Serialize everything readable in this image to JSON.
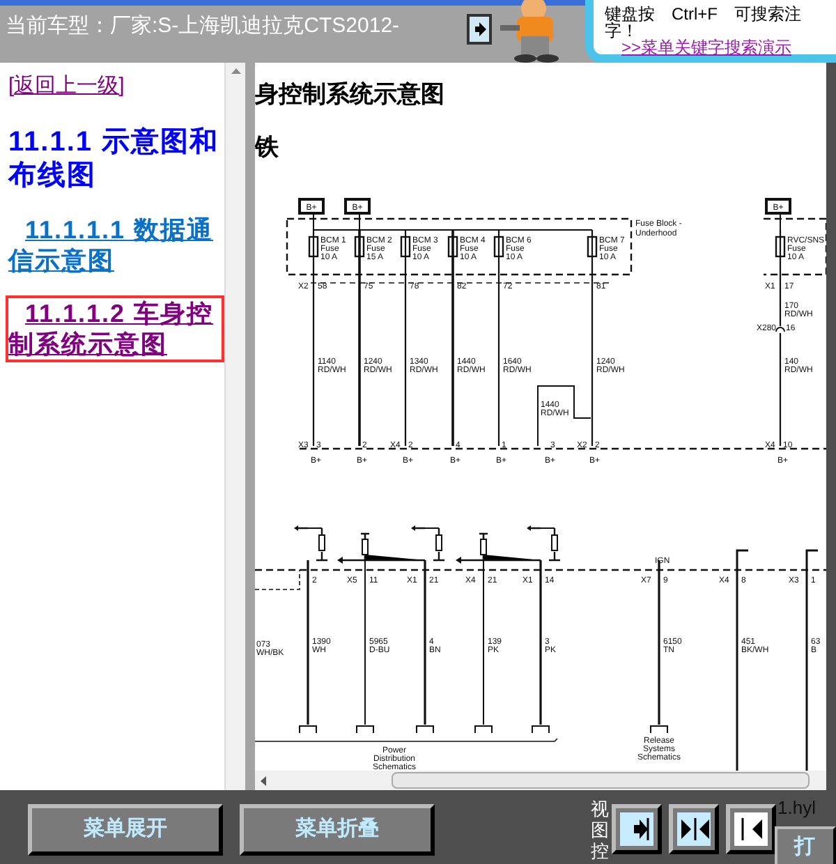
{
  "header": {
    "vehicle": "当前车型：厂家:S-上海凯迪拉克CTS2012-",
    "tip_lines": [
      "键盘按　Ctrl+F　可搜索注",
      "字！"
    ],
    "tip_link": ">>菜单关键字搜索演示"
  },
  "nav": [
    {
      "kind": "back",
      "text": "[返回上一级]",
      "selected": false
    },
    {
      "kind": "heading",
      "text": "11.1.1 示意图和布线图",
      "selected": false
    },
    {
      "kind": "link",
      "text": "11.1.1.1 数据通信示意图",
      "selected": false
    },
    {
      "kind": "link",
      "text": "11.1.1.2 车身控制系统示意图",
      "selected": true
    }
  ],
  "diagram": {
    "heading": "身控制系统示意图",
    "subheading": "铁",
    "fuse_block": [
      "Fuse Block -",
      "Underhood"
    ],
    "circuits": [
      {
        "kind": "fused",
        "supply": "B+",
        "fuse": "BCM 1",
        "fuse_word": "Fuse",
        "rating": "10 A",
        "top_connector": "X2",
        "top_pin": "58",
        "wire": "1140",
        "wire_color": "RD/WH",
        "connector": "X3",
        "pin": "3",
        "terminal": "B+"
      },
      {
        "kind": "fused",
        "supply": "B+",
        "fuse": "BCM 2",
        "fuse_word": "Fuse",
        "rating": "15 A",
        "top_pin": "75",
        "wire": "1240",
        "wire_color": "RD/WH",
        "pin": "2",
        "terminal": "B+"
      },
      {
        "kind": "fused",
        "fuse": "BCM 3",
        "fuse_word": "Fuse",
        "rating": "10 A",
        "top_pin": "78",
        "wire": "1340",
        "wire_color": "RD/WH",
        "connector": "X4",
        "pin": "2",
        "terminal": "B+"
      },
      {
        "kind": "fused",
        "fuse": "BCM 4",
        "fuse_word": "Fuse",
        "rating": "10 A",
        "top_pin": "82",
        "wire": "1440",
        "wire_color": "RD/WH",
        "pin": "4",
        "terminal": "B+"
      },
      {
        "kind": "fused",
        "fuse": "BCM 6",
        "fuse_word": "Fuse",
        "rating": "10 A",
        "top_pin": "72",
        "wire": "1640",
        "wire_color": "RD/WH",
        "pin": "1",
        "terminal": "B+"
      },
      {
        "kind": "jumper",
        "wire": "1440",
        "wire_color": "RD/WH",
        "pin": "3",
        "terminal": "B+"
      },
      {
        "kind": "fused",
        "fuse": "BCM 7",
        "fuse_word": "Fuse",
        "rating": "10 A",
        "top_pin": "81",
        "wire": "1240",
        "wire_color": "RD/WH",
        "connector": "X2",
        "pin": "2",
        "terminal": "B+"
      },
      {
        "kind": "inline",
        "supply": "B+",
        "fuse": "RVC/SNS",
        "fuse_word": "Fuse",
        "rating": "10 A",
        "top_connector": "X1",
        "top_pin": "17",
        "wire": "170",
        "wire_color": "RD/WH",
        "splice": "X280",
        "splice_pin": "16",
        "wire2": "140",
        "wire_color2": "RD/WH",
        "connector": "X4",
        "pin": "10",
        "terminal": "B+"
      }
    ],
    "outputs": [
      {
        "kind": "partial",
        "wire": "073",
        "wire_color": "WH/BK"
      },
      {
        "kind": "output",
        "pin": "2",
        "wire": "1390",
        "wire_color": "WH"
      },
      {
        "kind": "input",
        "connector": "X5",
        "pin": "11",
        "wire": "5965",
        "wire_color": "D-BU"
      },
      {
        "kind": "output",
        "connector": "X1",
        "pin": "21",
        "wire": "4",
        "wire_color": "BN"
      },
      {
        "kind": "input",
        "connector": "X4",
        "pin": "21",
        "wire": "139",
        "wire_color": "PK"
      },
      {
        "kind": "output",
        "connector": "X1",
        "pin": "14",
        "wire": "3",
        "wire_color": "PK"
      },
      {
        "kind": "ign",
        "label": "IGN",
        "connector": "X7",
        "pin": "9",
        "wire": "6150",
        "wire_color": "TN"
      },
      {
        "kind": "ground",
        "connector": "X4",
        "pin": "8",
        "wire": "451",
        "wire_color": "BK/WH"
      },
      {
        "kind": "ground",
        "connector": "X3",
        "pin": "1",
        "wire": "63",
        "wire_color": "B"
      }
    ],
    "references": [
      [
        "Power",
        "Distribution",
        "Schematics"
      ],
      [
        "Release",
        "Systems",
        "Schematics"
      ]
    ]
  },
  "footer": {
    "buttons": [
      "菜单展开",
      "菜单折叠"
    ],
    "view_label": "视图控",
    "view_buttons": [
      {
        "kind": "expand"
      },
      {
        "kind": "both"
      },
      {
        "kind": "collapse"
      }
    ],
    "file": "1.hyl",
    "print": "打"
  }
}
